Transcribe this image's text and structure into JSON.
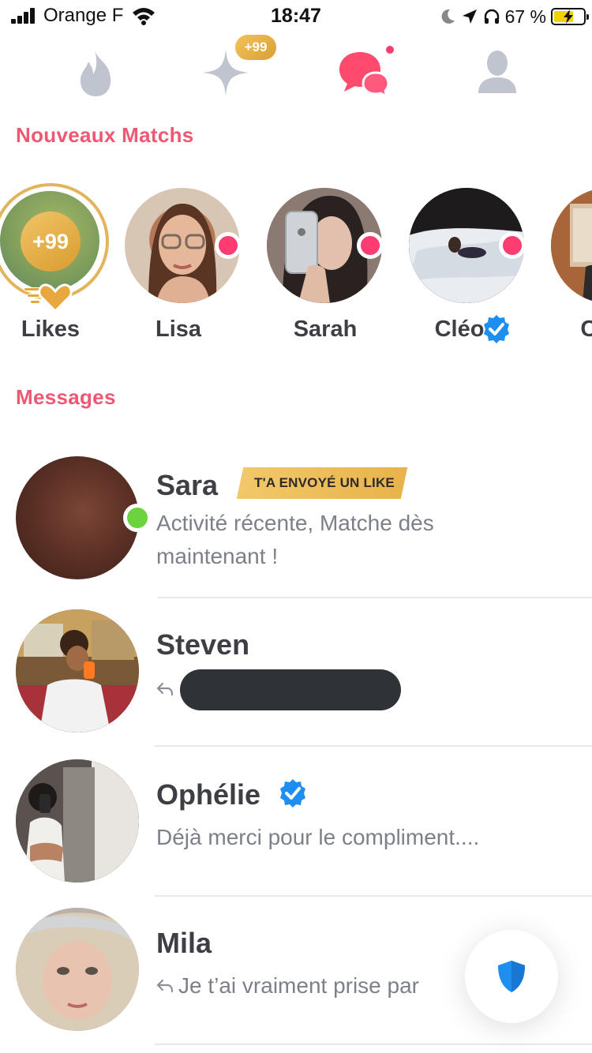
{
  "status_bar": {
    "carrier": "Orange F",
    "time": "18:47",
    "battery_percent": "67 %",
    "battery_level": 0.67
  },
  "nav": {
    "flame_icon": "flame-icon",
    "spark_icon": "sparkle-icon",
    "spark_badge": "+99",
    "chat_icon": "chat-bubbles-icon",
    "profile_icon": "profile-icon",
    "active_tab": "chat"
  },
  "matches_section": {
    "title": "Nouveaux Matchs",
    "likes": {
      "count": "+99",
      "label": "Likes"
    },
    "items": [
      {
        "name": "Lisa",
        "new": true,
        "verified": false
      },
      {
        "name": "Sarah",
        "new": true,
        "verified": false
      },
      {
        "name": "Cléo",
        "new": true,
        "verified": true
      },
      {
        "name": "Clé",
        "new": false,
        "verified": false
      }
    ]
  },
  "messages_section": {
    "title": "Messages",
    "items": [
      {
        "name": "Sara",
        "tag": "T'A ENVOYÉ UN LIKE",
        "preview_line1": "Activité récente, Matche dès",
        "preview_line2": "maintenant !",
        "online": true
      },
      {
        "name": "Steven",
        "preview": "",
        "replied": true
      },
      {
        "name": "Ophélie",
        "verified": true,
        "preview": "Déjà merci pour le compliment...."
      },
      {
        "name": "Mila",
        "replied": true,
        "preview": "Je t’ai vraiment prise par"
      }
    ]
  },
  "colors": {
    "accent": "#fe3c72",
    "section_title": "#ef5873",
    "gold": "#e3b45a",
    "verified": "#1f8ef1",
    "online": "#6ad33e",
    "shield": "#1f8ef1"
  }
}
